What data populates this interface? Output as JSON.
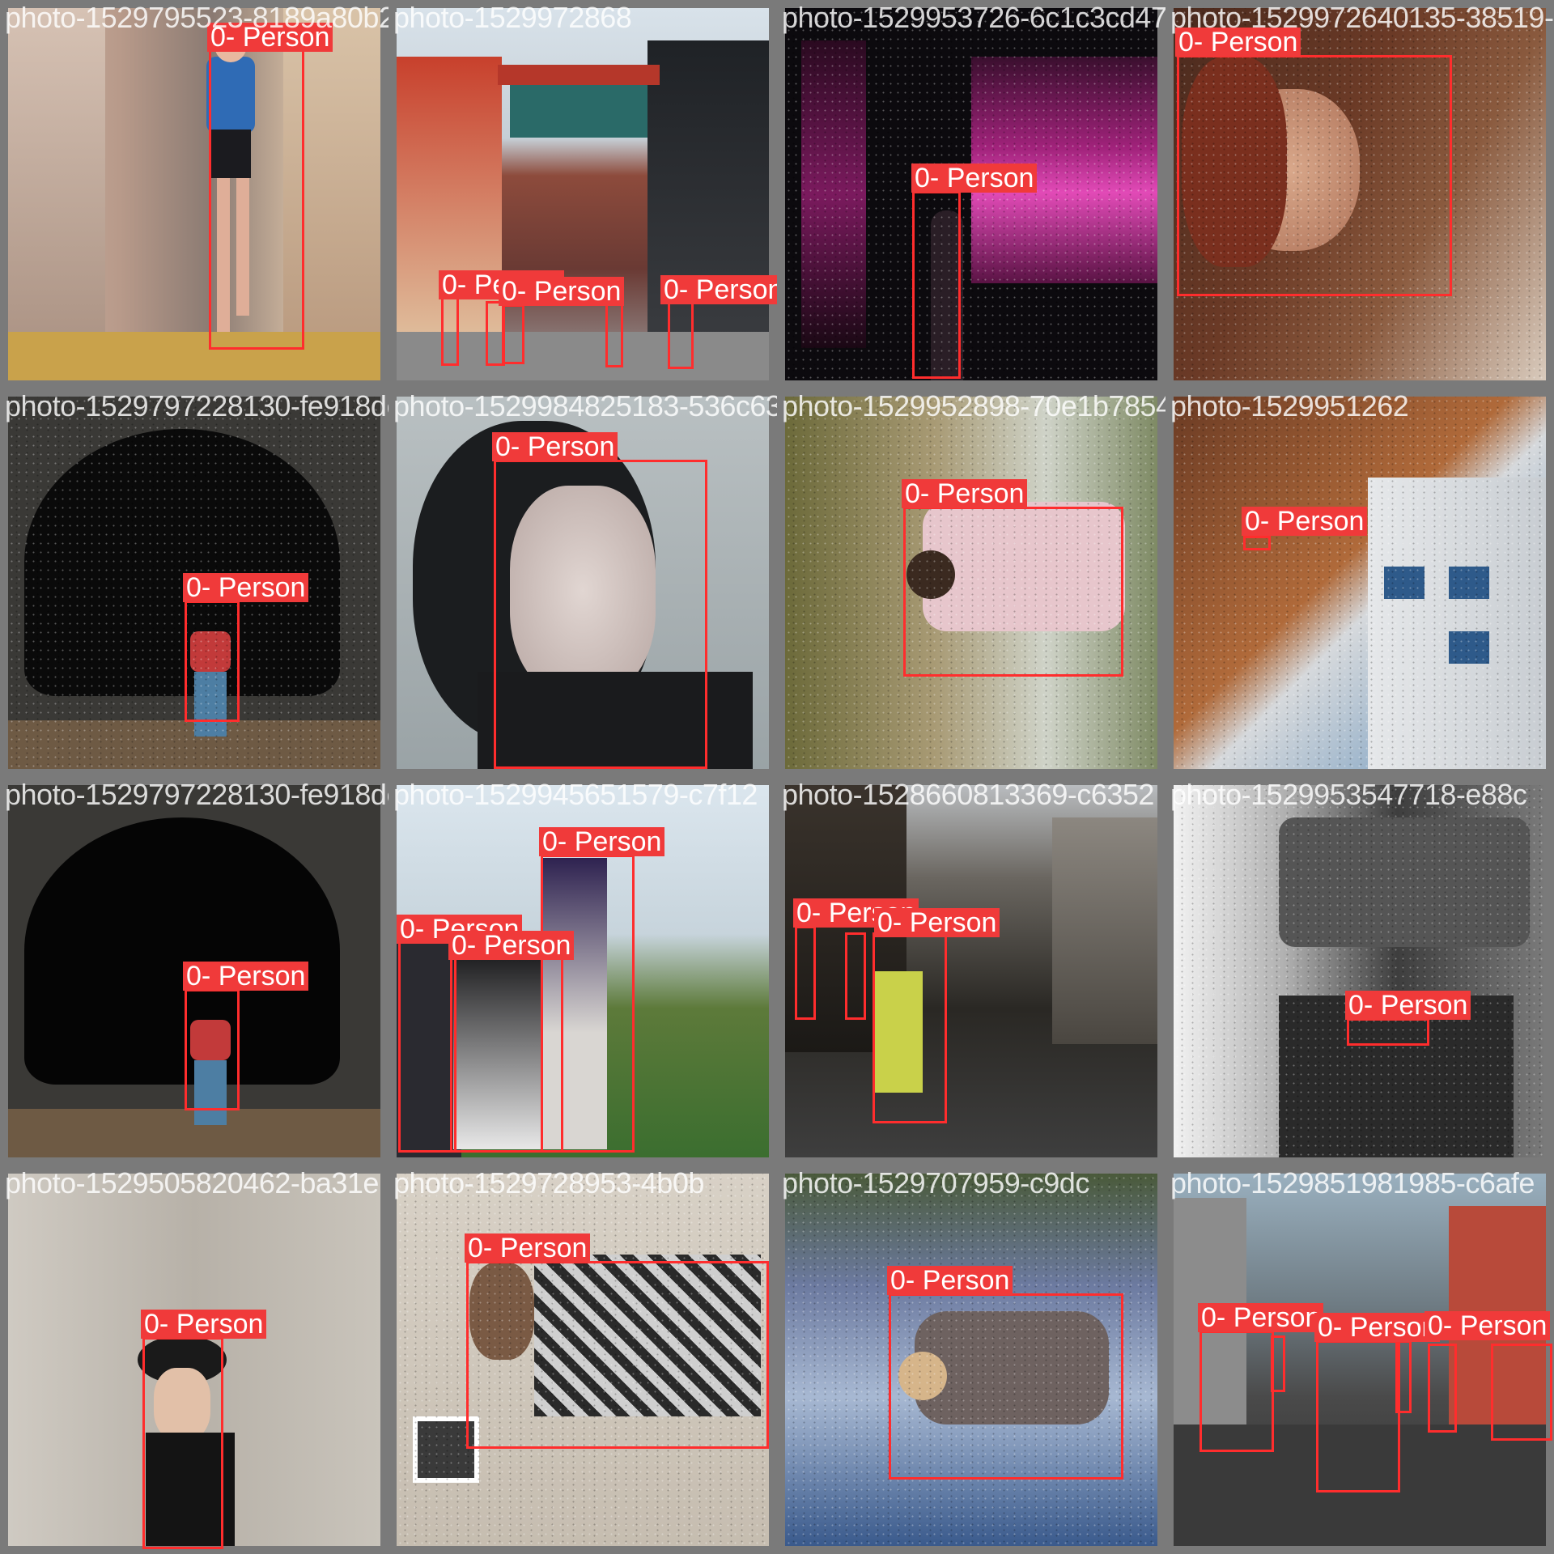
{
  "colors": {
    "box": "#ff2d2d",
    "label_bg": "#f03a3a",
    "frame": "#7a7a7a"
  },
  "label_prefix": "0- ",
  "class_name": "Person",
  "tiles": [
    {
      "filename": "photo-1529795523-8189a80b20b8-1529979519446336-39663f1f0-415-86804f51339-3df1e4e-91c6.jpg"
    },
    {
      "filename": "photo-1529972868"
    },
    {
      "filename": "photo-1529953726-6c1c3cd47691"
    },
    {
      "filename": "photo-1529972640135-38519-1747491-58f9"
    },
    {
      "filename": "photo-1529797228130-fe918dedd9115jpg"
    },
    {
      "filename": "photo-1529984825183-536c631760630"
    },
    {
      "filename": "photo-1529952898-70e1b785412657"
    },
    {
      "filename": "photo-1529951262"
    },
    {
      "filename": "photo-1529797228130-fe918dedd91153jpg"
    },
    {
      "filename": "photo-1529945651579-c7f12"
    },
    {
      "filename": "photo-1528660813369-c6352"
    },
    {
      "filename": "photo-1529953547718-e88c"
    },
    {
      "filename": "photo-1529505820462-ba31e"
    },
    {
      "filename": "photo-1529728953-4b0b"
    },
    {
      "filename": "photo-1529707959-c9dc"
    },
    {
      "filename": "photo-1529851981985-c6afe"
    }
  ]
}
